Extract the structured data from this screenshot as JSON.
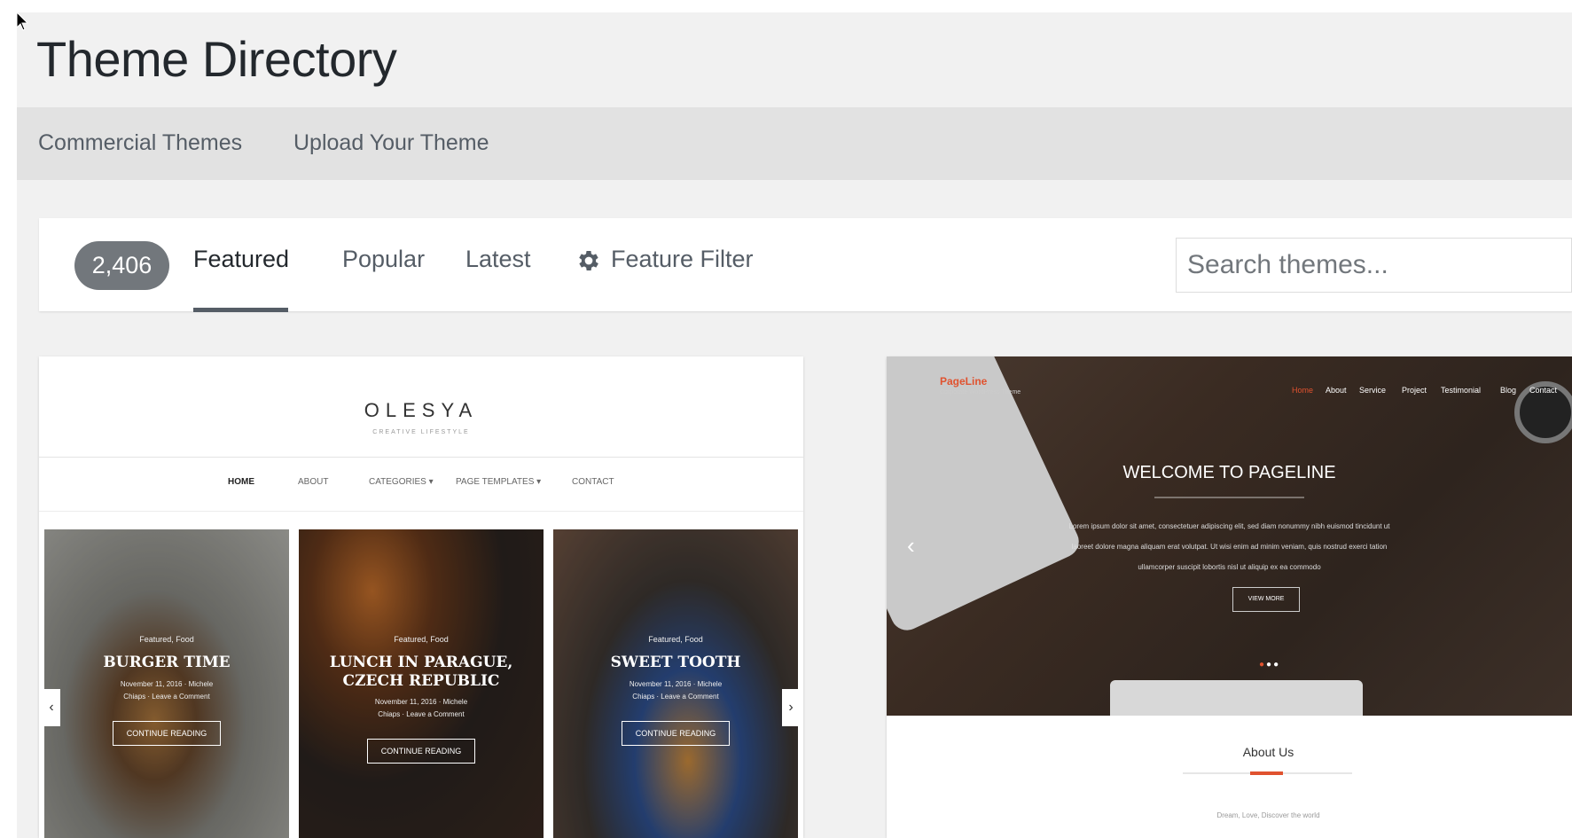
{
  "header": {
    "title": "Theme Directory"
  },
  "subnav": {
    "items": [
      "Commercial Themes",
      "Upload Your Theme"
    ]
  },
  "filter": {
    "count": "2,406",
    "tabs": [
      "Featured",
      "Popular",
      "Latest"
    ],
    "feature_filter": "Feature Filter",
    "search_placeholder": "Search themes..."
  },
  "themes": [
    {
      "logo": "OLESYA",
      "tagline": "CREATIVE LIFESTYLE",
      "nav": [
        "HOME",
        "ABOUT",
        "CATEGORIES ▾",
        "PAGE TEMPLATES ▾",
        "CONTACT"
      ],
      "posts": [
        {
          "category": "Featured, Food",
          "title": "BURGER TIME",
          "meta": "November 11, 2016 · Michele",
          "meta2": "Chiaps · Leave a Comment",
          "button": "CONTINUE READING"
        },
        {
          "category": "Featured, Food",
          "title": "LUNCH IN PARAGUE, CZECH REPUBLIC",
          "meta": "November 11, 2016 · Michele",
          "meta2": "Chiaps · Leave a Comment",
          "button": "CONTINUE READING"
        },
        {
          "category": "Featured, Food",
          "title": "SWEET TOOTH",
          "meta": "November 11, 2016 · Michele",
          "meta2": "Chiaps · Leave a Comment",
          "button": "CONTINUE READING"
        }
      ]
    },
    {
      "brand": "PageLine",
      "brand_sub": "Corporate WordPress Theme",
      "nav": [
        "Home",
        "About",
        "Service",
        "Project",
        "Testimonial",
        "Blog",
        "Contact"
      ],
      "welcome": "WELCOME TO PAGELINE",
      "lorem": "Lorem ipsum dolor sit amet, consectetuer adipiscing elit, sed diam nonummy nibh euismod tincidunt ut laoreet dolore magna aliquam erat volutpat. Ut wisi enim ad minim veniam, quis nostrud exerci tation ullamcorper suscipit lobortis nisl ut aliquip ex ea commodo",
      "more": "VIEW MORE",
      "about": "About Us",
      "about_sub": "Dream, Love, Discover the world"
    }
  ],
  "colors": {
    "accent": "#e0522f",
    "pill": "#72777c",
    "subnav_bg": "#e2e2e2"
  }
}
